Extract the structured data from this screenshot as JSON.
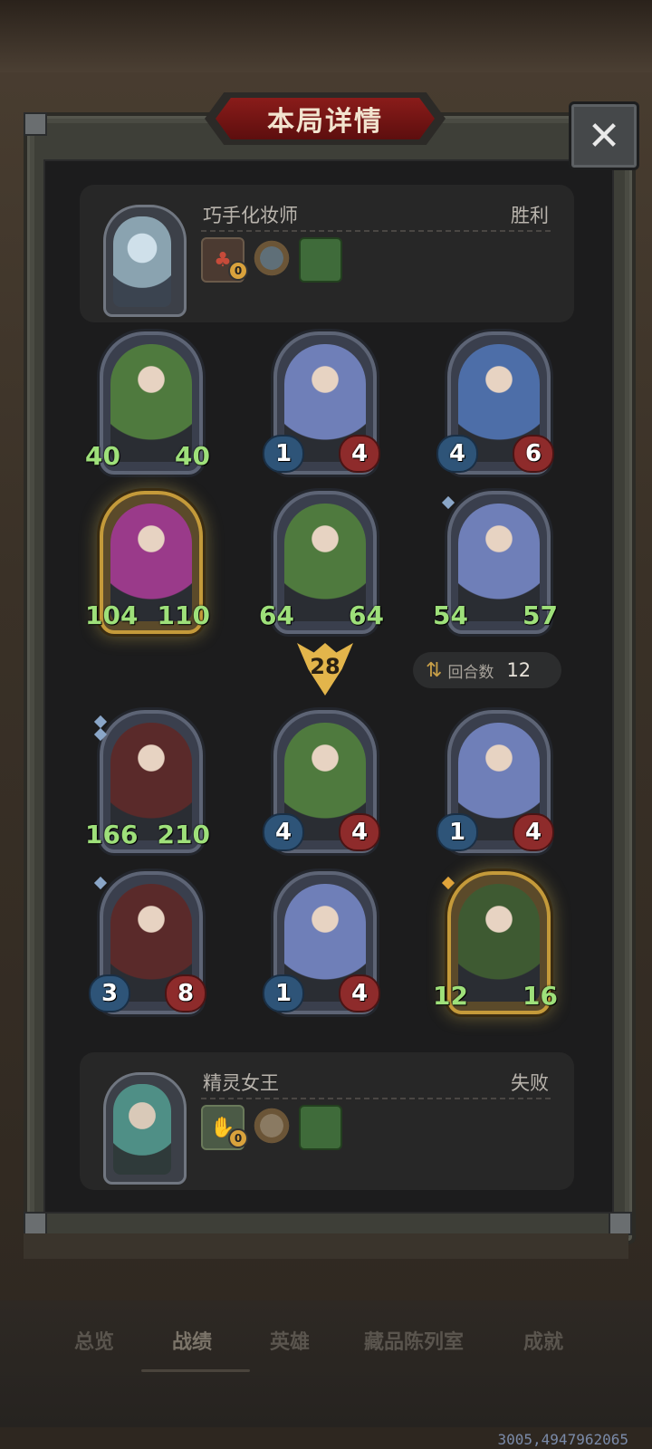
{
  "header": {
    "title": "本局详情",
    "close_icon": "close-icon"
  },
  "winner": {
    "name": "巧手化妆师",
    "result": "胜利",
    "items": [
      {
        "icon": "potion-card-icon",
        "coin": "0"
      },
      {
        "icon": "pocket-watch-icon"
      },
      {
        "icon": "green-book-icon"
      }
    ],
    "colors": {
      "avatar": "#8aa3b0"
    }
  },
  "board_top": [
    {
      "atk": "40",
      "hp": "40",
      "style": "big",
      "art": "#4f7a3e"
    },
    {
      "atk": "1",
      "hp": "4",
      "style": "normal",
      "art": "#6f7fb8"
    },
    {
      "atk": "4",
      "hp": "6",
      "style": "normal",
      "art": "#4d6ea8"
    },
    {
      "atk": "104",
      "hp": "110",
      "style": "big",
      "gold": true,
      "art": "#9a3a8a"
    },
    {
      "atk": "64",
      "hp": "64",
      "style": "big",
      "art": "#4f7a3e"
    },
    {
      "atk": "54",
      "hp": "57",
      "style": "big",
      "gem": 1,
      "art": "#6f7fb8"
    }
  ],
  "round_marker": {
    "value": "28"
  },
  "turns": {
    "label": "回合数",
    "value": "12"
  },
  "board_bottom": [
    {
      "atk": "166",
      "hp": "210",
      "style": "big",
      "gem": 2,
      "art": "#5a2a2a"
    },
    {
      "atk": "4",
      "hp": "4",
      "style": "normal",
      "art": "#4f7a3e"
    },
    {
      "atk": "1",
      "hp": "4",
      "style": "normal",
      "art": "#6f7fb8"
    },
    {
      "atk": "3",
      "hp": "8",
      "style": "normal",
      "gem": 1,
      "art": "#5a2a2a"
    },
    {
      "atk": "1",
      "hp": "4",
      "style": "normal",
      "art": "#6f7fb8"
    },
    {
      "atk": "12",
      "hp": "16",
      "style": "big",
      "gold": true,
      "gemGold": true,
      "art": "#3e5a32"
    }
  ],
  "loser": {
    "name": "精灵女王",
    "result": "失败",
    "items": [
      {
        "icon": "hand-card-icon",
        "coin": "0"
      },
      {
        "icon": "pocket-watch-icon"
      },
      {
        "icon": "green-book-icon"
      }
    ],
    "colors": {
      "avatar": "#4f8f86"
    }
  },
  "nav": {
    "items": [
      "总览",
      "战绩",
      "英雄",
      "藏品陈列室",
      "成就"
    ],
    "active": "战绩"
  },
  "coords_text": "3005,4947962065"
}
